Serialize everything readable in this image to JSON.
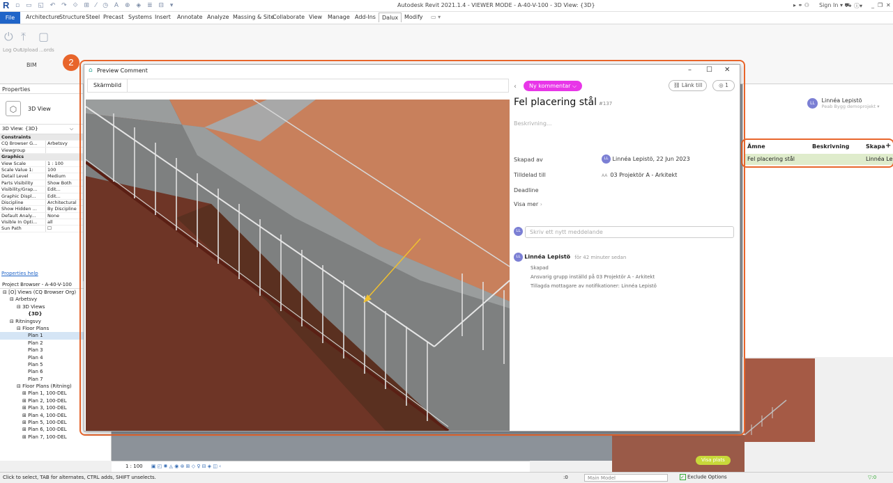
{
  "app": {
    "title": "Autodesk Revit 2021.1.4 - VIEWER MODE - A-40-V-100 - 3D View: {3D}",
    "sign_in": "Sign In",
    "qat_glyphs": "▫ ▭ ◱ ↶ ↷ ⟐ ⊞ ⁄ ◷ A ⊕ ◈ ≣ ⊟ ▾"
  },
  "ribbon": {
    "tabs": [
      "File",
      "Architecture",
      "Structure",
      "Steel",
      "Precast",
      "Systems",
      "Insert",
      "Annotate",
      "Analyze",
      "Massing & Site",
      "Collaborate",
      "View",
      "Manage",
      "Add-Ins",
      "Dalux",
      "Modify"
    ],
    "active_tab": "Dalux",
    "buttons": {
      "logout": "Log Out",
      "upload": "Upload",
      "third": "...ords"
    },
    "panel_label": "BIM"
  },
  "properties": {
    "title": "Properties",
    "type_name": "3D View",
    "selector": "3D View: {3D}",
    "rows": [
      {
        "k": "Constraints",
        "v": "",
        "cat": true
      },
      {
        "k": "CQ Browser G...",
        "v": "Arbetsvy"
      },
      {
        "k": "Viewgroup",
        "v": ""
      },
      {
        "k": "Graphics",
        "v": "",
        "cat": true
      },
      {
        "k": "View Scale",
        "v": "1 : 100"
      },
      {
        "k": "Scale Value   1:",
        "v": "100"
      },
      {
        "k": "Detail Level",
        "v": "Medium"
      },
      {
        "k": "Parts Visibility",
        "v": "Show Both"
      },
      {
        "k": "Visibility/Grap...",
        "v": "Edit..."
      },
      {
        "k": "Graphic Displ...",
        "v": "Edit..."
      },
      {
        "k": "Discipline",
        "v": "Architectural"
      },
      {
        "k": "Show Hidden ...",
        "v": "By Discipline"
      },
      {
        "k": "Default Analy...",
        "v": "None"
      },
      {
        "k": "Visible In Opti...",
        "v": "all"
      },
      {
        "k": "Sun Path",
        "v": "☐"
      }
    ],
    "help": "Properties help"
  },
  "browser": {
    "title": "Project Browser - A-40-V-100",
    "items": [
      {
        "label": "⊟ [O] Views (CQ Browser Org)",
        "indent": 4
      },
      {
        "label": "⊟ Arbetsvy",
        "indent": 14
      },
      {
        "label": "⊟ 3D Views",
        "indent": 24
      },
      {
        "label": "{3D}",
        "indent": 40,
        "bold": true
      },
      {
        "label": "⊟ Ritningsvy",
        "indent": 14
      },
      {
        "label": "⊟ Floor Plans",
        "indent": 24
      },
      {
        "label": "Plan 1",
        "indent": 40,
        "sel": true
      },
      {
        "label": "Plan 2",
        "indent": 40
      },
      {
        "label": "Plan 3",
        "indent": 40
      },
      {
        "label": "Plan 4",
        "indent": 40
      },
      {
        "label": "Plan 5",
        "indent": 40
      },
      {
        "label": "Plan 6",
        "indent": 40
      },
      {
        "label": "Plan 7",
        "indent": 40
      },
      {
        "label": "⊟ Floor Plans (Ritning)",
        "indent": 24
      },
      {
        "label": "⊞ Plan 1, 100-DEL",
        "indent": 32
      },
      {
        "label": "⊞ Plan 2, 100-DEL",
        "indent": 32
      },
      {
        "label": "⊞ Plan 3, 100-DEL",
        "indent": 32
      },
      {
        "label": "⊞ Plan 4, 100-DEL",
        "indent": 32
      },
      {
        "label": "⊞ Plan 5, 100-DEL",
        "indent": 32
      },
      {
        "label": "⊞ Plan 6, 100-DEL",
        "indent": 32
      },
      {
        "label": "⊞ Plan 7, 100-DEL",
        "indent": 32
      }
    ]
  },
  "viewbar": {
    "scale": "1 : 100"
  },
  "statusbar": {
    "hint": "Click to select, TAB for alternates, CTRL adds, SHIFT unselects.",
    "zero": ":0",
    "model": "Main Model",
    "exclude": "Exclude Options",
    "filter": "▽:0"
  },
  "dalux_panel": {
    "user_name": "Linnéa Lepistö",
    "project": "Peab Bygg demoprojekt ▾",
    "user_initials": "LL",
    "columns": [
      "Ämne",
      "Beskrivning",
      "Skapa"
    ],
    "rows": [
      {
        "subject": "Fel placering stål",
        "desc": "",
        "created": "Linnéa Le"
      }
    ],
    "visa_plats": "Visa plats"
  },
  "badges": {
    "one": "1",
    "two": "2"
  },
  "preview": {
    "window_title": "Preview Comment",
    "tab_label": "Skärmbild",
    "pill": "Ny kommentar ⌵",
    "link_btn": "⛓ Länk till",
    "eye_btn": "◎ 1",
    "title": "Fel placering stål",
    "number": "#137",
    "description_placeholder": "Beskrivning...",
    "created_by_label": "Skapad av",
    "created_by_value": "Linnéa Lepistö, 22 Jun 2023",
    "assigned_label": "Tilldelad till",
    "assigned_initials": "AA",
    "assigned_value": "03 Projektör A - Arkitekt",
    "deadline_label": "Deadline",
    "show_more": "Visa mer",
    "message_placeholder": "Skriv ett nytt meddelande",
    "log_name": "Linnéa Lepistö",
    "log_time": "för 42 minuter sedan",
    "log_lines": [
      "Skapad",
      "Ansvarig grupp inställd på 03 Projektör A - Arkitekt",
      "Tillagda mottagare av notifikationer: Linnéa Lepistö"
    ]
  },
  "colors": {
    "accent": "#e8652b",
    "pill": "#e836e8",
    "avatar": "#7b7fd4",
    "row_highlight": "#dfeccc",
    "arrow": "#f0c030"
  }
}
